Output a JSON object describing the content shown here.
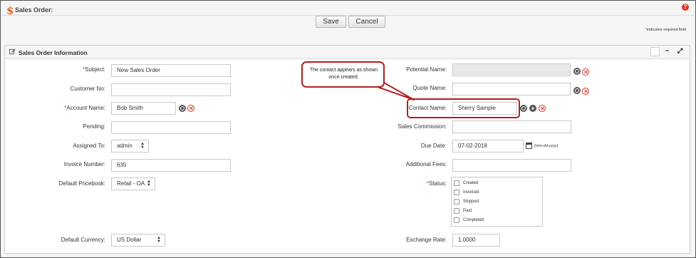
{
  "header": {
    "title": "Sales Order:",
    "save_label": "Save",
    "cancel_label": "Cancel",
    "required_note": "indicates required field"
  },
  "panel": {
    "title": "Sales Order Information",
    "controls": [
      "",
      "−",
      "⤢"
    ]
  },
  "fields": {
    "subject": {
      "label": "Subject:",
      "value": "New Sales Order",
      "required": true
    },
    "customer_no": {
      "label": "Customer No:",
      "value": ""
    },
    "account_name": {
      "label": "Account Name:",
      "value": "Bob Smith",
      "required": true
    },
    "pending": {
      "label": "Pending:",
      "value": ""
    },
    "assigned_to": {
      "label": "Assigned To:",
      "value": "admin"
    },
    "invoice_number": {
      "label": "Invoice Number:",
      "value": "635"
    },
    "default_pricebook": {
      "label": "Default Pricebook:",
      "value": "Retail - OA"
    },
    "default_currency": {
      "label": "Default Currency:",
      "value": "US Dollar"
    },
    "potential_name": {
      "label": "Potential Name:",
      "value": ""
    },
    "quote_name": {
      "label": "Quote Name:",
      "value": ""
    },
    "contact_name": {
      "label": "Contact Name:",
      "value": "Sherry Sample"
    },
    "sales_commission": {
      "label": "Sales Commission:",
      "value": ""
    },
    "due_date": {
      "label": "Due Date:",
      "value": "07-02-2018",
      "hint": "(mm-dd-yyyy)"
    },
    "additional_fees": {
      "label": "Additional Fees:",
      "value": ""
    },
    "status": {
      "label": "Status:",
      "required": true,
      "options": [
        "Created",
        "Invoiced",
        "Shipped",
        "Paid",
        "Completed"
      ]
    },
    "exchange_rate": {
      "label": "Exchange Rate:",
      "value": "1.0000"
    }
  },
  "callout": {
    "line1": "The contact appears as shown",
    "line2": "once created."
  },
  "colors": {
    "accent": "#b32020",
    "required": "#d9342b",
    "dollar": "#e0672a"
  }
}
